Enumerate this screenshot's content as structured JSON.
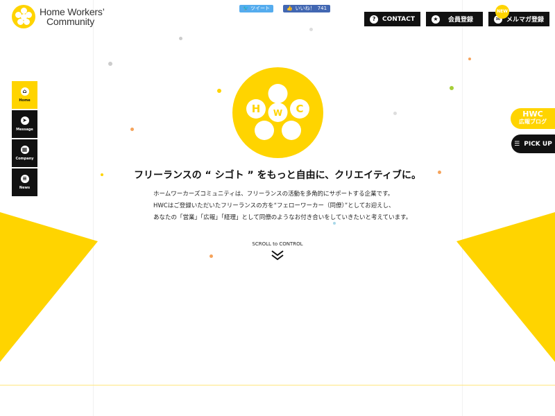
{
  "logo": {
    "line1": "Home Workers’",
    "line2": "Community"
  },
  "social": {
    "tweet_label": "ツイート",
    "like_label": "いいね！",
    "like_count": "741"
  },
  "topnav": {
    "contact": "CONTACT",
    "register": "会員登録",
    "mailmag": "メルマガ登録",
    "new_badge": "NEW"
  },
  "sidenav": [
    {
      "label": "Home",
      "icon": "home-icon"
    },
    {
      "label": "Message",
      "icon": "paper-plane-icon"
    },
    {
      "label": "Company",
      "icon": "building-icon"
    },
    {
      "label": "News",
      "icon": "document-icon"
    }
  ],
  "right_tabs": {
    "blog_line1": "HWC",
    "blog_line2": "広報ブログ",
    "pickup": "PICK UP"
  },
  "hero": {
    "emblem_letters": [
      "H",
      "W",
      "C"
    ],
    "tagline": "フリーランスの “ シゴト ” をもっと自由に、クリエイティブに。",
    "description": [
      "ホームワーカーズコミュニティは、フリーランスの活動を多角的にサポートする企業です。",
      "HWCはご登録いただいたフリーランスの方を“フェローワーカー（同僚）”としてお迎えし、",
      "あなたの「営業」「広報」「経理」として同僚のようなお付き合いをしていきたいと考えています。"
    ],
    "scroll_label": "SCROLL to CONTROL"
  },
  "colors": {
    "brand_yellow": "#ffd400",
    "black": "#111111",
    "twitter": "#55acee",
    "facebook": "#4267b2"
  }
}
